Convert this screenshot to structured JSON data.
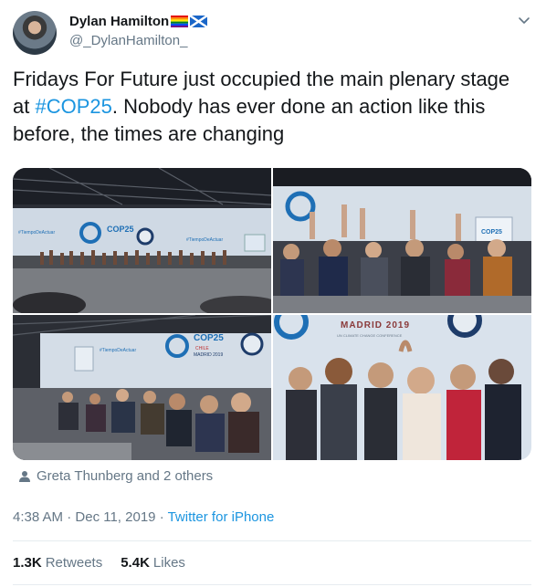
{
  "author": {
    "display_name": "Dylan Hamilton",
    "handle": "@_DylanHamilton_"
  },
  "tweet": {
    "text_before": "Fridays For Future just occupied the main plenary stage at ",
    "hashtag": "#COP25",
    "text_after": ". Nobody has ever done an action like this before, the times are changing"
  },
  "photos": {
    "stage_banner": "COP25",
    "stage_country": "CHILE",
    "stage_city": "MADRID 2019",
    "banner_hashtag": "#TiempoDeActuar",
    "conference_city": "MADRID 2019",
    "conference_sub": "UN CLIMATE CHANGE CONFERENCE"
  },
  "tagged": {
    "text": "Greta Thunberg and 2 others",
    "icon": "person-icon"
  },
  "meta": {
    "time": "4:38 AM",
    "date": "Dec 11, 2019",
    "separator": "·",
    "source": "Twitter for iPhone"
  },
  "stats": {
    "retweets_count": "1.3K",
    "retweets_label": "Retweets",
    "likes_count": "5.4K",
    "likes_label": "Likes"
  },
  "colors": {
    "link": "#1b95e0",
    "secondary": "#657786",
    "text": "#14171a",
    "border": "#e6ecf0"
  }
}
